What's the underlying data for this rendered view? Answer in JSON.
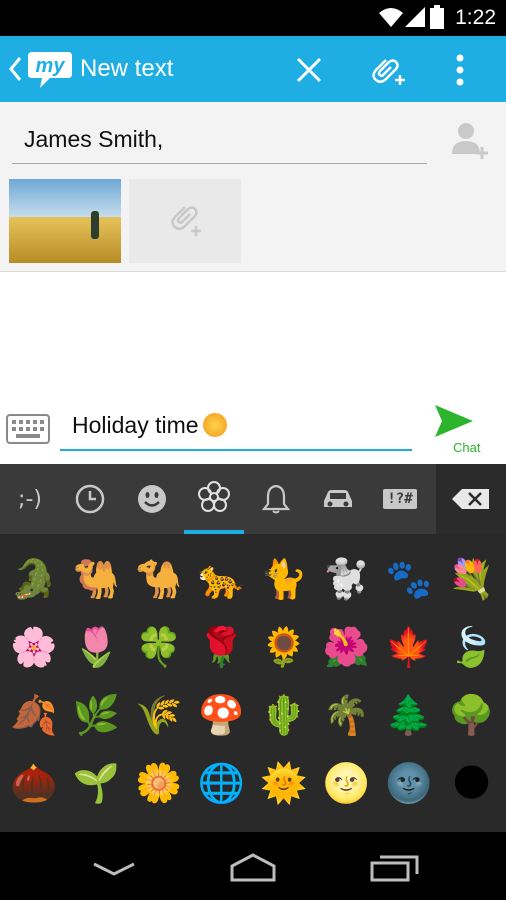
{
  "status_bar": {
    "time": "1:22"
  },
  "app_bar": {
    "title": "New text",
    "logo_text": "my"
  },
  "recipient": {
    "value": "James Smith,"
  },
  "compose": {
    "value": "Holiday time",
    "send_label": "Chat"
  },
  "emoji_tabs": [
    {
      "name": "emoticon-tab",
      "label": ";-)"
    },
    {
      "name": "recent-tab",
      "icon": "clock-icon"
    },
    {
      "name": "smiley-tab",
      "icon": "smiley-icon"
    },
    {
      "name": "nature-tab",
      "icon": "flower-icon",
      "active": true
    },
    {
      "name": "objects-tab",
      "icon": "bell-icon"
    },
    {
      "name": "places-tab",
      "icon": "car-icon"
    },
    {
      "name": "symbols-tab",
      "label": "!?#"
    }
  ],
  "emojis": [
    "🐊",
    "🐫",
    "🐪",
    "🐆",
    "🐈",
    "🐩",
    "🐾",
    "💐",
    "🌸",
    "🌷",
    "🍀",
    "🌹",
    "🌻",
    "🌺",
    "🍁",
    "🍃",
    "🍂",
    "🌿",
    "🌾",
    "🍄",
    "🌵",
    "🌴",
    "🌲",
    "🌳",
    "🌰",
    "🌱",
    "🌼",
    "🌐",
    "🌞",
    "🌝",
    "🌚",
    "🌑"
  ],
  "colors": {
    "accent": "#1eaee3",
    "send": "#2cb52c",
    "keyboard_bg": "#292929"
  }
}
